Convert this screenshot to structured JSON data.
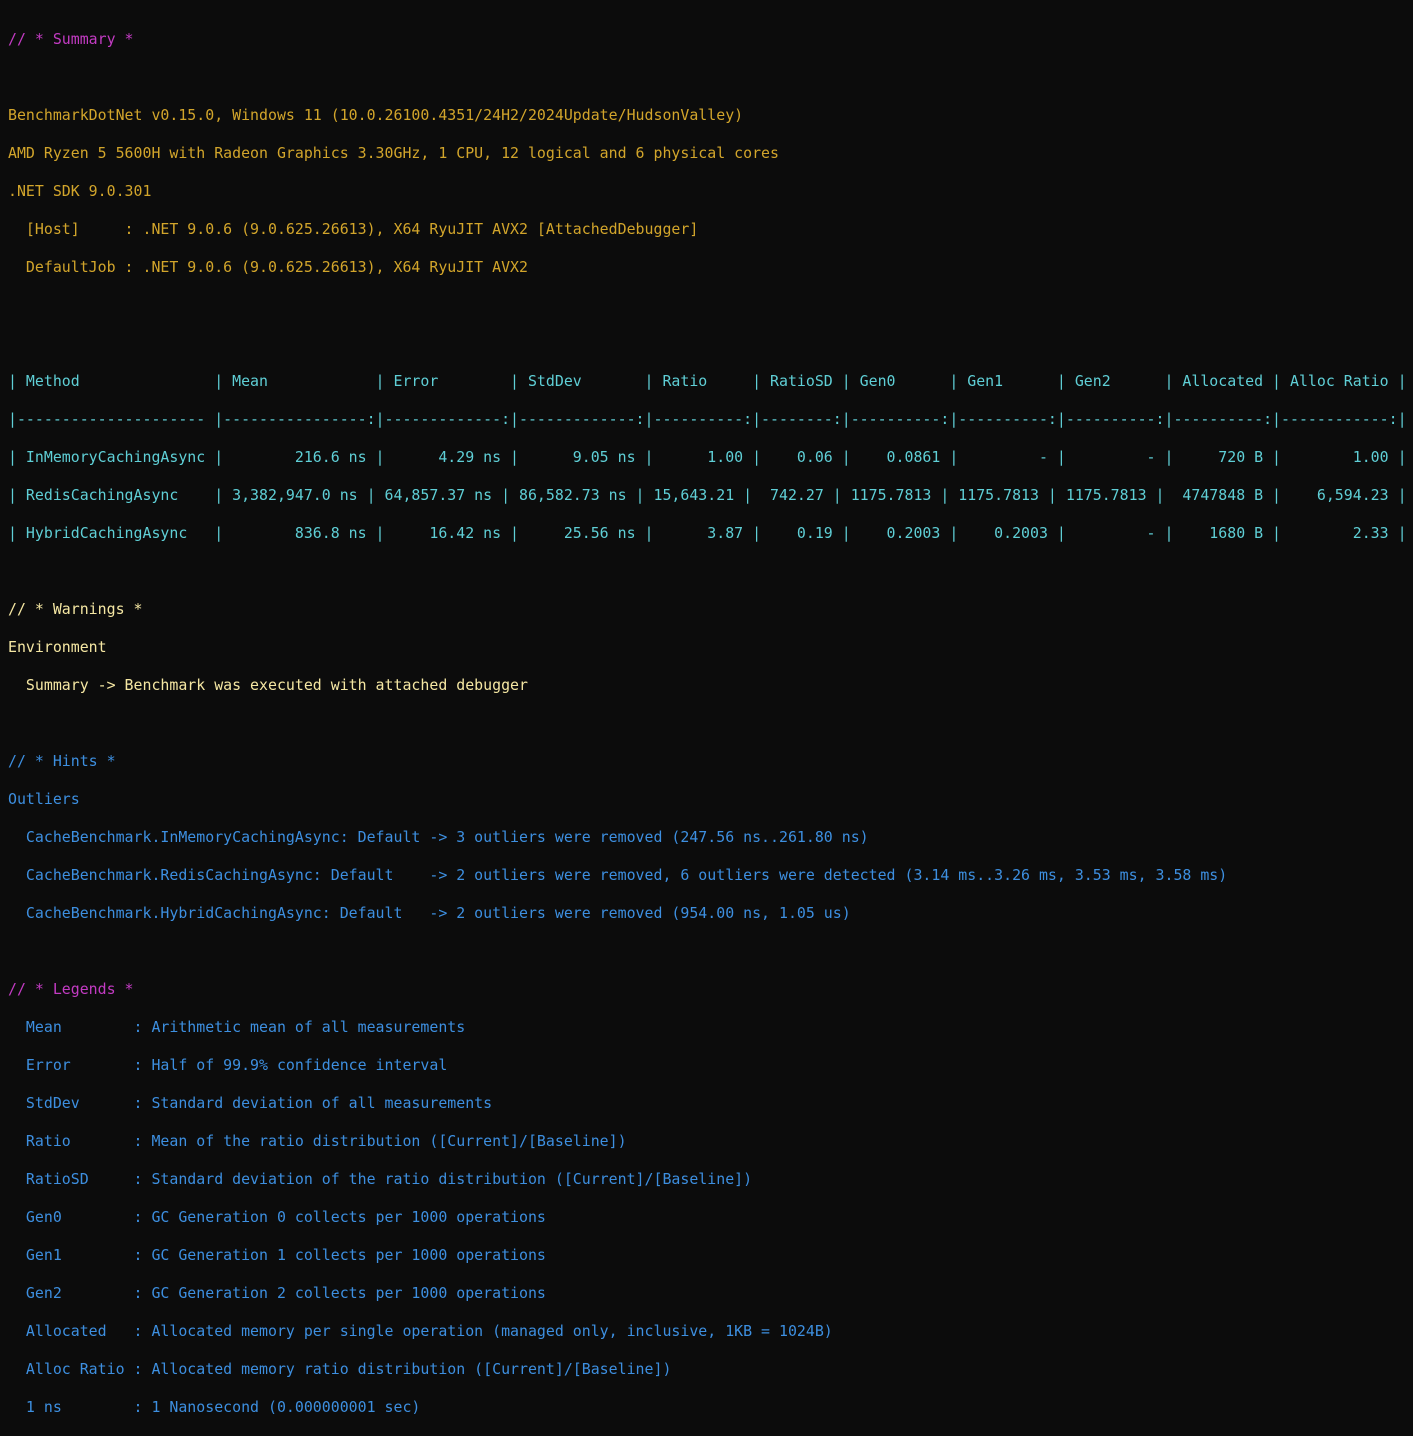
{
  "summary": {
    "heading": "// * Summary *",
    "env": [
      "BenchmarkDotNet v0.15.0, Windows 11 (10.0.26100.4351/24H2/2024Update/HudsonValley)",
      "AMD Ryzen 5 5600H with Radeon Graphics 3.30GHz, 1 CPU, 12 logical and 6 physical cores",
      ".NET SDK 9.0.301",
      "  [Host]     : .NET 9.0.6 (9.0.625.26613), X64 RyuJIT AVX2 [AttachedDebugger]",
      "  DefaultJob : .NET 9.0.6 (9.0.625.26613), X64 RyuJIT AVX2"
    ]
  },
  "table": {
    "header": "| Method               | Mean            | Error        | StdDev       | Ratio     | RatioSD | Gen0      | Gen1      | Gen2      | Allocated | Alloc Ratio |",
    "separator": "|--------------------- |----------------:|-------------:|-------------:|----------:|--------:|----------:|----------:|----------:|----------:|------------:|",
    "rows": [
      "| InMemoryCachingAsync |        216.6 ns |      4.29 ns |      9.05 ns |      1.00 |    0.06 |    0.0861 |         - |         - |     720 B |        1.00 |",
      "| RedisCachingAsync    | 3,382,947.0 ns | 64,857.37 ns | 86,582.73 ns | 15,643.21 |  742.27 | 1175.7813 | 1175.7813 | 1175.7813 |  4747848 B |    6,594.23 |",
      "| HybridCachingAsync   |        836.8 ns |     16.42 ns |     25.56 ns |      3.87 |    0.19 |    0.2003 |    0.2003 |         - |    1680 B |        2.33 |"
    ]
  },
  "warnings": {
    "heading": "// * Warnings *",
    "lines": [
      "Environment",
      "  Summary -> Benchmark was executed with attached debugger"
    ]
  },
  "hints": {
    "heading": "// * Hints *",
    "title": "Outliers",
    "lines": [
      "  CacheBenchmark.InMemoryCachingAsync: Default -> 3 outliers were removed (247.56 ns..261.80 ns)",
      "  CacheBenchmark.RedisCachingAsync: Default    -> 2 outliers were removed, 6 outliers were detected (3.14 ms..3.26 ms, 3.53 ms, 3.58 ms)",
      "  CacheBenchmark.HybridCachingAsync: Default   -> 2 outliers were removed (954.00 ns, 1.05 us)"
    ]
  },
  "legends": {
    "heading": "// * Legends *",
    "lines": [
      "  Mean        : Arithmetic mean of all measurements",
      "  Error       : Half of 99.9% confidence interval",
      "  StdDev      : Standard deviation of all measurements",
      "  Ratio       : Mean of the ratio distribution ([Current]/[Baseline])",
      "  RatioSD     : Standard deviation of the ratio distribution ([Current]/[Baseline])",
      "  Gen0        : GC Generation 0 collects per 1000 operations",
      "  Gen1        : GC Generation 1 collects per 1000 operations",
      "  Gen2        : GC Generation 2 collects per 1000 operations",
      "  Allocated   : Allocated memory per single operation (managed only, inclusive, 1KB = 1024B)",
      "  Alloc Ratio : Allocated memory ratio distribution ([Current]/[Baseline])",
      "  1 ns        : 1 Nanosecond (0.000000001 sec)"
    ]
  },
  "colors": {
    "background": "#0c0c0c",
    "heading": "#c33bc3",
    "environment": "#d2a52b",
    "table": "#5fcfd6",
    "warning": "#f5e7a3",
    "hint": "#3d8fe0"
  }
}
